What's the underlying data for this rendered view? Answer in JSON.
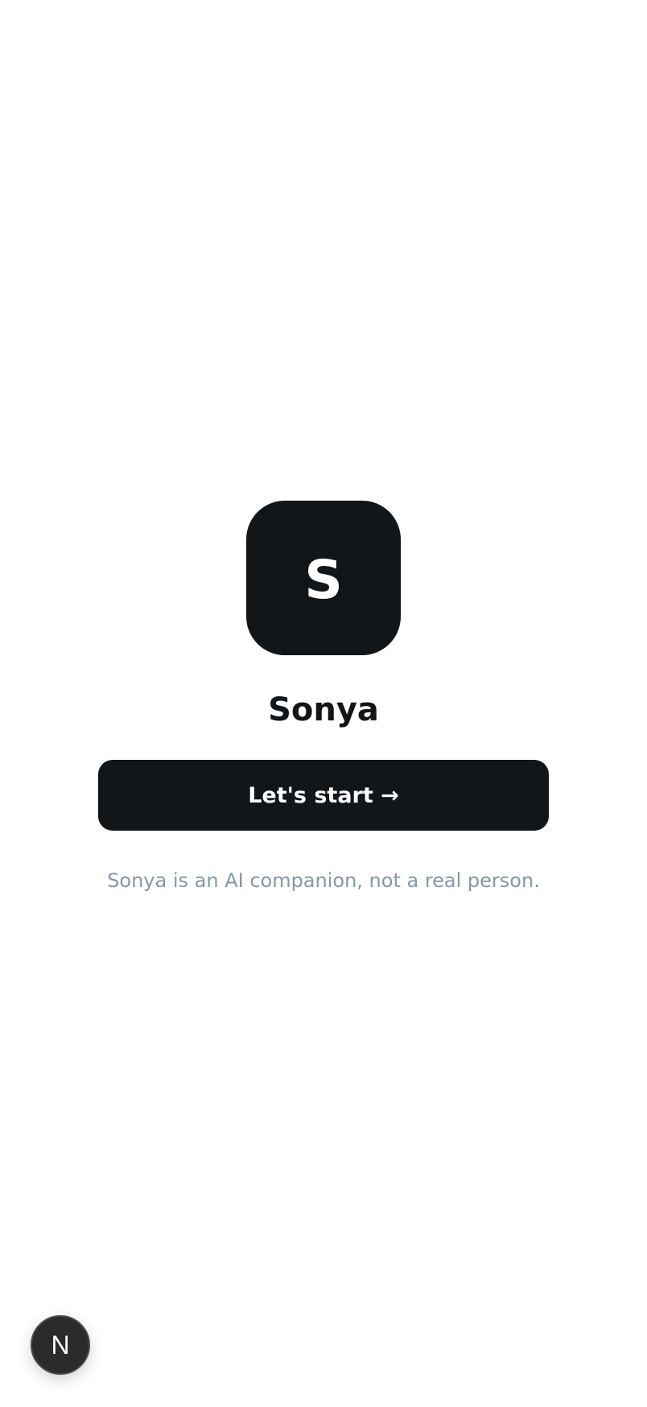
{
  "avatar": {
    "letter": "S",
    "background": "#121619"
  },
  "app": {
    "name": "Sonya"
  },
  "cta": {
    "label": "Let's start →"
  },
  "disclaimer": "Sonya is an AI companion, not a real person.",
  "dev_badge": {
    "letter": "N",
    "icon": "nextjs-logo-icon"
  },
  "colors": {
    "primary": "#121619",
    "muted_text": "#8796a8",
    "background": "#ffffff"
  }
}
